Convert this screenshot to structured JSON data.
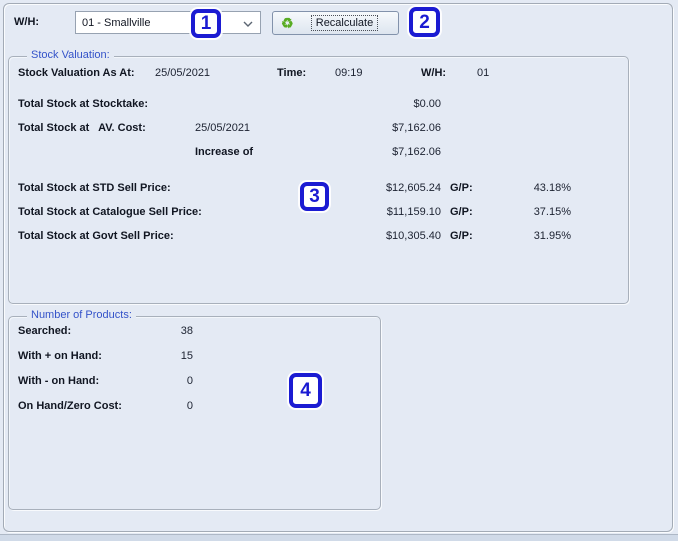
{
  "colors": {
    "background": "#e4eaf4",
    "accent_blue_title": "#3453c9",
    "annotation_blue": "#1b1bd2",
    "recycle_green": "#58ac22"
  },
  "header": {
    "wh_label": "W/H:",
    "wh_dropdown_value": "01 - Smallville",
    "recalculate_button": "Recalculate",
    "recycle_glyph": "♻︎"
  },
  "stock_valuation": {
    "title": "Stock Valuation:",
    "as_at_row": {
      "label": "Stock Valuation As At:",
      "date": "25/05/2021",
      "time_label": "Time:",
      "time": "09:19",
      "wh_label": "W/H:",
      "wh": "01"
    },
    "stocktake_row": {
      "label": "Total Stock at Stocktake:",
      "amount": "$0.00"
    },
    "av_cost_row": {
      "label": "Total Stock at   AV. Cost:",
      "date": "25/05/2021",
      "amount": "$7,162.06"
    },
    "increase_row": {
      "label": "Increase of",
      "amount": "$7,162.06"
    },
    "sell_rows": [
      {
        "label": "Total Stock at STD Sell Price:",
        "amount": "$12,605.24",
        "gp_label": "G/P:",
        "gp": "43.18%"
      },
      {
        "label": "Total Stock at Catalogue Sell Price:",
        "amount": "$11,159.10",
        "gp_label": "G/P:",
        "gp": "37.15%"
      },
      {
        "label": "Total Stock at Govt Sell Price:",
        "amount": "$10,305.40",
        "gp_label": "G/P:",
        "gp": "31.95%"
      }
    ]
  },
  "number_of_products": {
    "title": "Number of Products:",
    "rows": [
      {
        "label": "Searched:",
        "value": "38"
      },
      {
        "label": "With + on Hand:",
        "value": "15"
      },
      {
        "label": "With - on Hand:",
        "value": "0"
      },
      {
        "label": "On Hand/Zero Cost:",
        "value": "0"
      }
    ]
  },
  "annotations": [
    {
      "label": "1"
    },
    {
      "label": "2"
    },
    {
      "label": "3"
    },
    {
      "label": "4"
    }
  ]
}
